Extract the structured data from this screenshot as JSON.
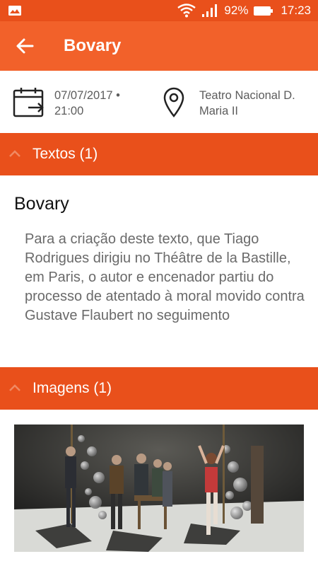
{
  "status_bar": {
    "battery": "92%",
    "time": "17:23",
    "icons": [
      "gallery-icon",
      "wifi-icon",
      "signal-icon",
      "battery-icon"
    ]
  },
  "app_bar": {
    "title": "Bovary",
    "back_icon": "arrow-back-icon"
  },
  "event": {
    "date_line1": "07/07/2017 •",
    "date_line2": "21:00",
    "venue_line1": "Teatro Nacional D.",
    "venue_line2": "Maria II"
  },
  "sections": {
    "textos": {
      "label": "Textos (1)",
      "items": [
        {
          "title": "Bovary",
          "excerpt": "Para a criação deste texto, que Tiago Rodrigues dirigiu no Théâtre de la Bastille, em Paris, o autor e encenador partiu do processo de atentado à moral movido contra Gustave Flaubert no seguimento"
        }
      ]
    },
    "imagens": {
      "label": "Imagens (1)"
    }
  },
  "colors": {
    "status_bar": "#e9501b",
    "app_bar": "#f2612a",
    "section_header": "#e9501b"
  }
}
